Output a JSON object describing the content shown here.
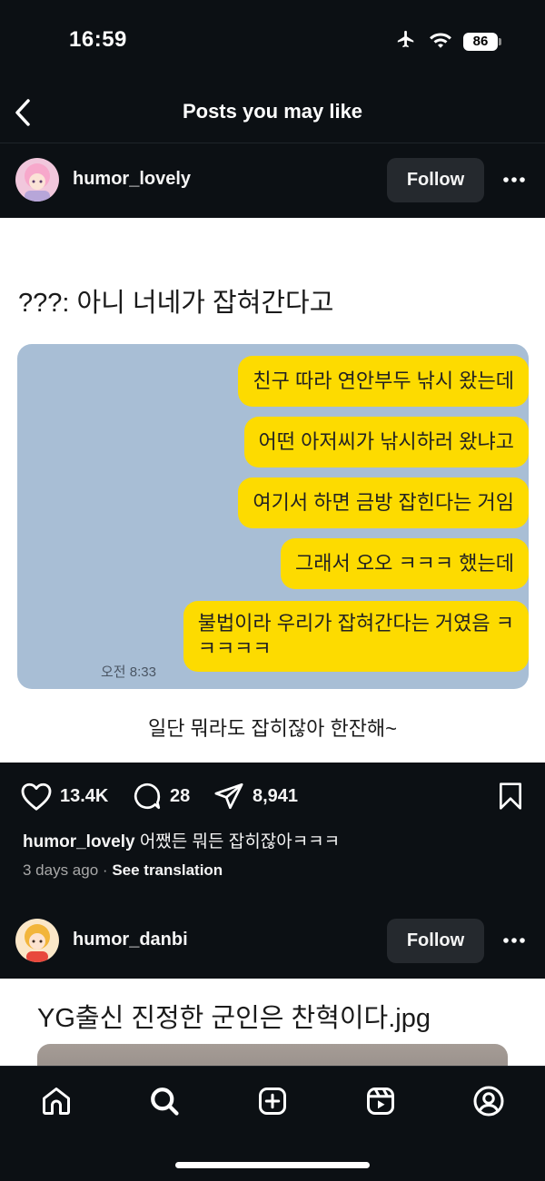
{
  "status_bar": {
    "time": "16:59",
    "battery": "86"
  },
  "header": {
    "title": "Posts you may like"
  },
  "posts": [
    {
      "username": "humor_lovely",
      "follow_label": "Follow",
      "image_title": "???: 아니 너네가 잡혀간다고",
      "chat_messages": [
        "친구 따라 연안부두 낚시 왔는데",
        "어떤 아저씨가 낚시하러 왔냐고",
        "여기서 하면 금방 잡힌다는 거임",
        "그래서 오오 ㅋㅋㅋ 했는데",
        "불법이라 우리가 잡혀간다는 거였음 ㅋ\nㅋㅋㅋㅋ"
      ],
      "chat_time": "오전 8:33",
      "image_footer": "일단 뭐라도 잡히잖아 한잔해~",
      "likes": "13.4K",
      "comments": "28",
      "shares": "8,941",
      "caption_user": "humor_lovely",
      "caption_text": " 어쨌든 뭐든 잡히잖아ㅋㅋㅋ",
      "time_ago": "3 days ago",
      "see_translation": "See translation"
    },
    {
      "username": "humor_danbi",
      "follow_label": "Follow",
      "image_title": "YG출신 진정한 군인은 찬혁이다.jpg"
    }
  ],
  "colors": {
    "background": "#0c1014",
    "bubble": "#fddb00",
    "chat_bg": "#a8bed5",
    "button": "#25292e"
  },
  "bottom_nav": [
    "home-icon",
    "search-icon",
    "create-icon",
    "reels-icon",
    "profile-icon"
  ]
}
